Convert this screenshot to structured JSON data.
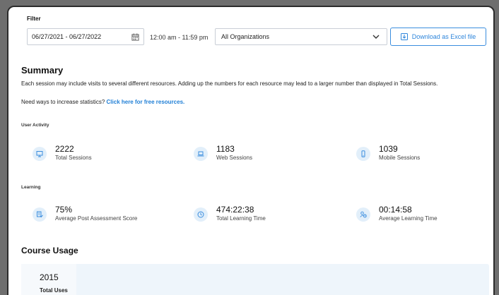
{
  "filter": {
    "label": "Filter",
    "date_range": "06/27/2021 - 06/27/2022",
    "time_range": "12:00 am - 11:59 pm",
    "organization": "All Organizations",
    "download_label": "Download as Excel file"
  },
  "summary": {
    "title": "Summary",
    "description": "Each session may include visits to several different resources. Adding up the numbers for each resource may lead to a larger number than displayed in Total Sessions.",
    "stats_prompt": "Need ways to increase statistics?",
    "stats_link": "Click here for free resources."
  },
  "user_activity": {
    "label": "User Activity",
    "metrics": [
      {
        "value": "2222",
        "label": "Total Sessions",
        "icon": "monitor-icon"
      },
      {
        "value": "1183",
        "label": "Web Sessions",
        "icon": "laptop-icon"
      },
      {
        "value": "1039",
        "label": "Mobile Sessions",
        "icon": "mobile-icon"
      }
    ]
  },
  "learning": {
    "label": "Learning",
    "metrics": [
      {
        "value": "75%",
        "label": "Average Post Assessment Score",
        "icon": "assessment-icon"
      },
      {
        "value": "474:22:38",
        "label": "Total Learning Time",
        "icon": "clock-icon"
      },
      {
        "value": "00:14:58",
        "label": "Average Learning Time",
        "icon": "user-clock-icon"
      }
    ]
  },
  "course_usage": {
    "title": "Course Usage",
    "total_value": "2015",
    "total_label": "Total Uses"
  },
  "colors": {
    "accent": "#2f86db",
    "icon_bg": "#e2effa",
    "card_bg": "#eef5fb"
  }
}
